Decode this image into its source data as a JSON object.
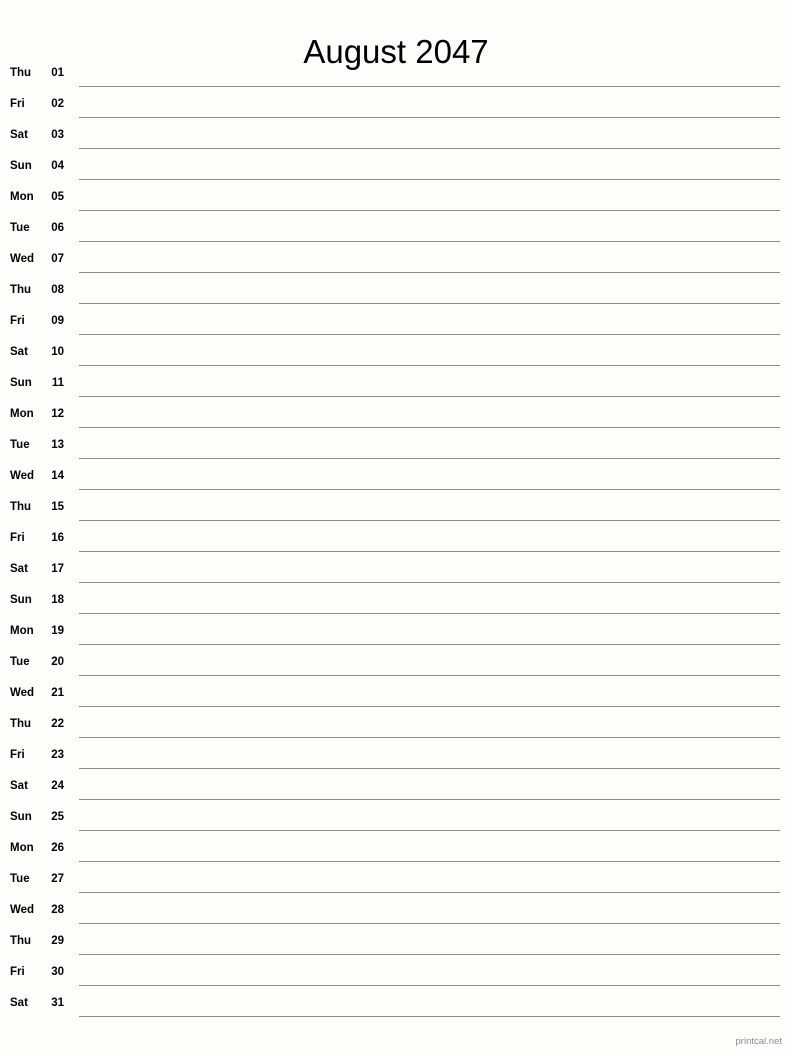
{
  "document": {
    "type": "printable-monthly-calendar",
    "title": "August 2047",
    "month": "August",
    "year": "2047"
  },
  "colors": {
    "background": "#fdfdfa",
    "text": "#000000",
    "rule_line": "#8a8a8a",
    "footer_text": "#8c8c8c"
  },
  "rows": [
    {
      "weekday": "Thu",
      "date": "01"
    },
    {
      "weekday": "Fri",
      "date": "02"
    },
    {
      "weekday": "Sat",
      "date": "03"
    },
    {
      "weekday": "Sun",
      "date": "04"
    },
    {
      "weekday": "Mon",
      "date": "05"
    },
    {
      "weekday": "Tue",
      "date": "06"
    },
    {
      "weekday": "Wed",
      "date": "07"
    },
    {
      "weekday": "Thu",
      "date": "08"
    },
    {
      "weekday": "Fri",
      "date": "09"
    },
    {
      "weekday": "Sat",
      "date": "10"
    },
    {
      "weekday": "Sun",
      "date": "11"
    },
    {
      "weekday": "Mon",
      "date": "12"
    },
    {
      "weekday": "Tue",
      "date": "13"
    },
    {
      "weekday": "Wed",
      "date": "14"
    },
    {
      "weekday": "Thu",
      "date": "15"
    },
    {
      "weekday": "Fri",
      "date": "16"
    },
    {
      "weekday": "Sat",
      "date": "17"
    },
    {
      "weekday": "Sun",
      "date": "18"
    },
    {
      "weekday": "Mon",
      "date": "19"
    },
    {
      "weekday": "Tue",
      "date": "20"
    },
    {
      "weekday": "Wed",
      "date": "21"
    },
    {
      "weekday": "Thu",
      "date": "22"
    },
    {
      "weekday": "Fri",
      "date": "23"
    },
    {
      "weekday": "Sat",
      "date": "24"
    },
    {
      "weekday": "Sun",
      "date": "25"
    },
    {
      "weekday": "Mon",
      "date": "26"
    },
    {
      "weekday": "Tue",
      "date": "27"
    },
    {
      "weekday": "Wed",
      "date": "28"
    },
    {
      "weekday": "Thu",
      "date": "29"
    },
    {
      "weekday": "Fri",
      "date": "30"
    },
    {
      "weekday": "Sat",
      "date": "31"
    }
  ],
  "footer": {
    "credit": "printcal.net"
  }
}
